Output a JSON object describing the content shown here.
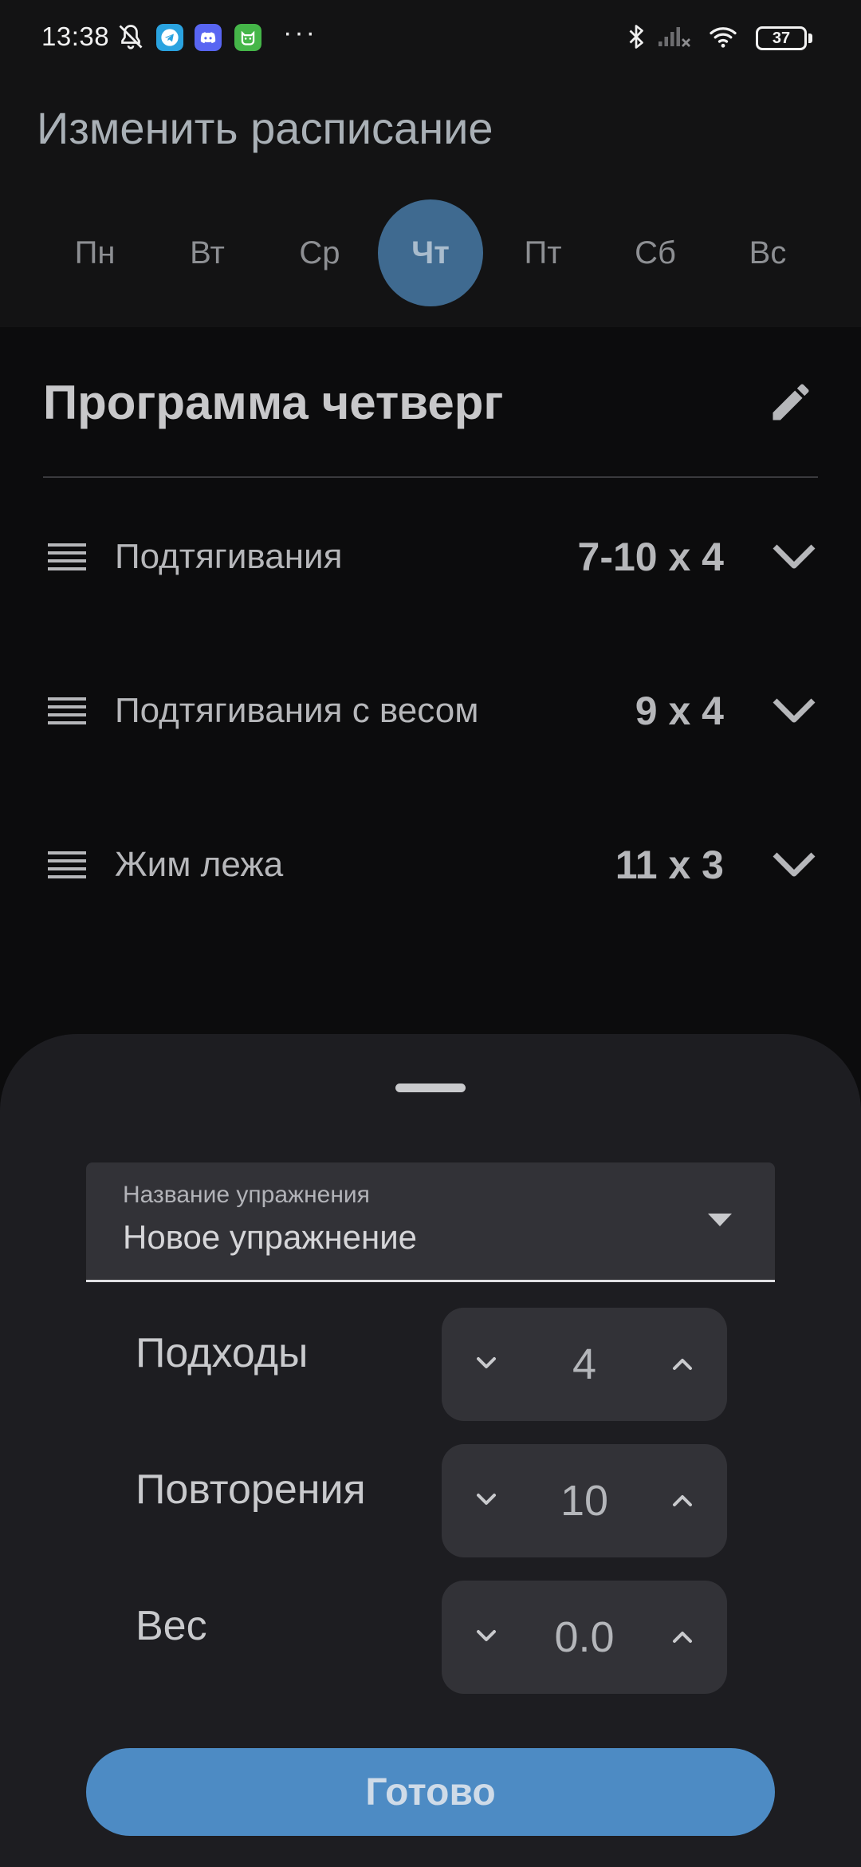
{
  "status_bar": {
    "time": "13:38",
    "more": "···",
    "battery_level": "37",
    "icons": [
      "mute-bell-icon",
      "telegram-icon",
      "discord-icon",
      "cat-app-icon",
      "bluetooth-icon",
      "signal-icon",
      "wifi-icon",
      "battery-icon"
    ]
  },
  "header": {
    "title": "Изменить расписание"
  },
  "days": {
    "selected": "Чт",
    "items": [
      {
        "label": "Пн"
      },
      {
        "label": "Вт"
      },
      {
        "label": "Ср"
      },
      {
        "label": "Чт"
      },
      {
        "label": "Пт"
      },
      {
        "label": "Сб"
      },
      {
        "label": "Вс"
      }
    ]
  },
  "program": {
    "title": "Программа четверг",
    "exercises": [
      {
        "name": "Подтягивания",
        "sets": "7-10 x 4"
      },
      {
        "name": "Подтягивания с весом",
        "sets": "9 x 4"
      },
      {
        "name": "Жим лежа",
        "sets": "11 x 3"
      }
    ]
  },
  "sheet": {
    "exercise_field": {
      "label": "Название упражнения",
      "value": "Новое упражнение"
    },
    "params": [
      {
        "label": "Подходы",
        "value": "4"
      },
      {
        "label": "Повторения",
        "value": "10"
      },
      {
        "label": "Вес",
        "value": "0.0"
      }
    ],
    "done_label": "Готово"
  },
  "colors": {
    "accent": "#4d8bc4",
    "selected_day": "#3f6a90",
    "sheet_bg": "#1d1d21",
    "field_bg": "#323237"
  }
}
